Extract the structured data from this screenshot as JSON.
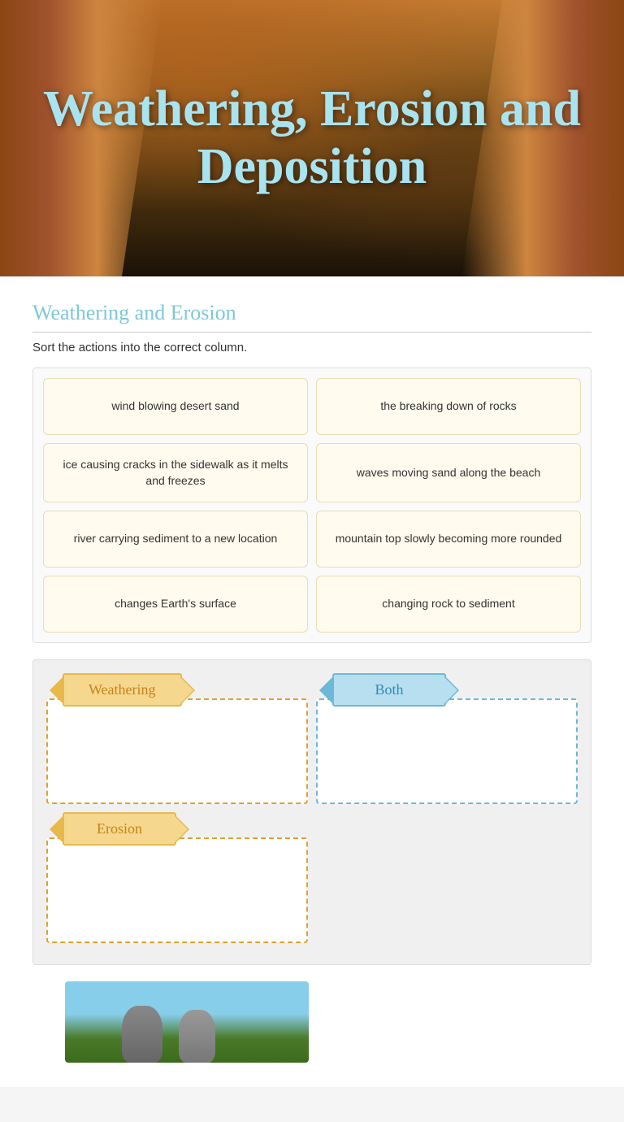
{
  "hero": {
    "title": "Weathering, Erosion and Deposition"
  },
  "section": {
    "title": "Weathering and Erosion",
    "instructions": "Sort the actions into the correct column."
  },
  "cards": [
    {
      "id": "card1",
      "text": "wind blowing desert sand"
    },
    {
      "id": "card2",
      "text": "the breaking down of rocks"
    },
    {
      "id": "card3",
      "text": "ice causing cracks in the sidewalk as it melts and freezes"
    },
    {
      "id": "card4",
      "text": "waves moving sand along the beach"
    },
    {
      "id": "card5",
      "text": "river carrying sediment to a new location"
    },
    {
      "id": "card6",
      "text": "mountain top slowly becoming more rounded"
    },
    {
      "id": "card7",
      "text": "changes Earth's surface"
    },
    {
      "id": "card8",
      "text": "changing rock to sediment"
    }
  ],
  "sort": {
    "weathering_label": "Weathering",
    "both_label": "Both",
    "erosion_label": "Erosion"
  }
}
